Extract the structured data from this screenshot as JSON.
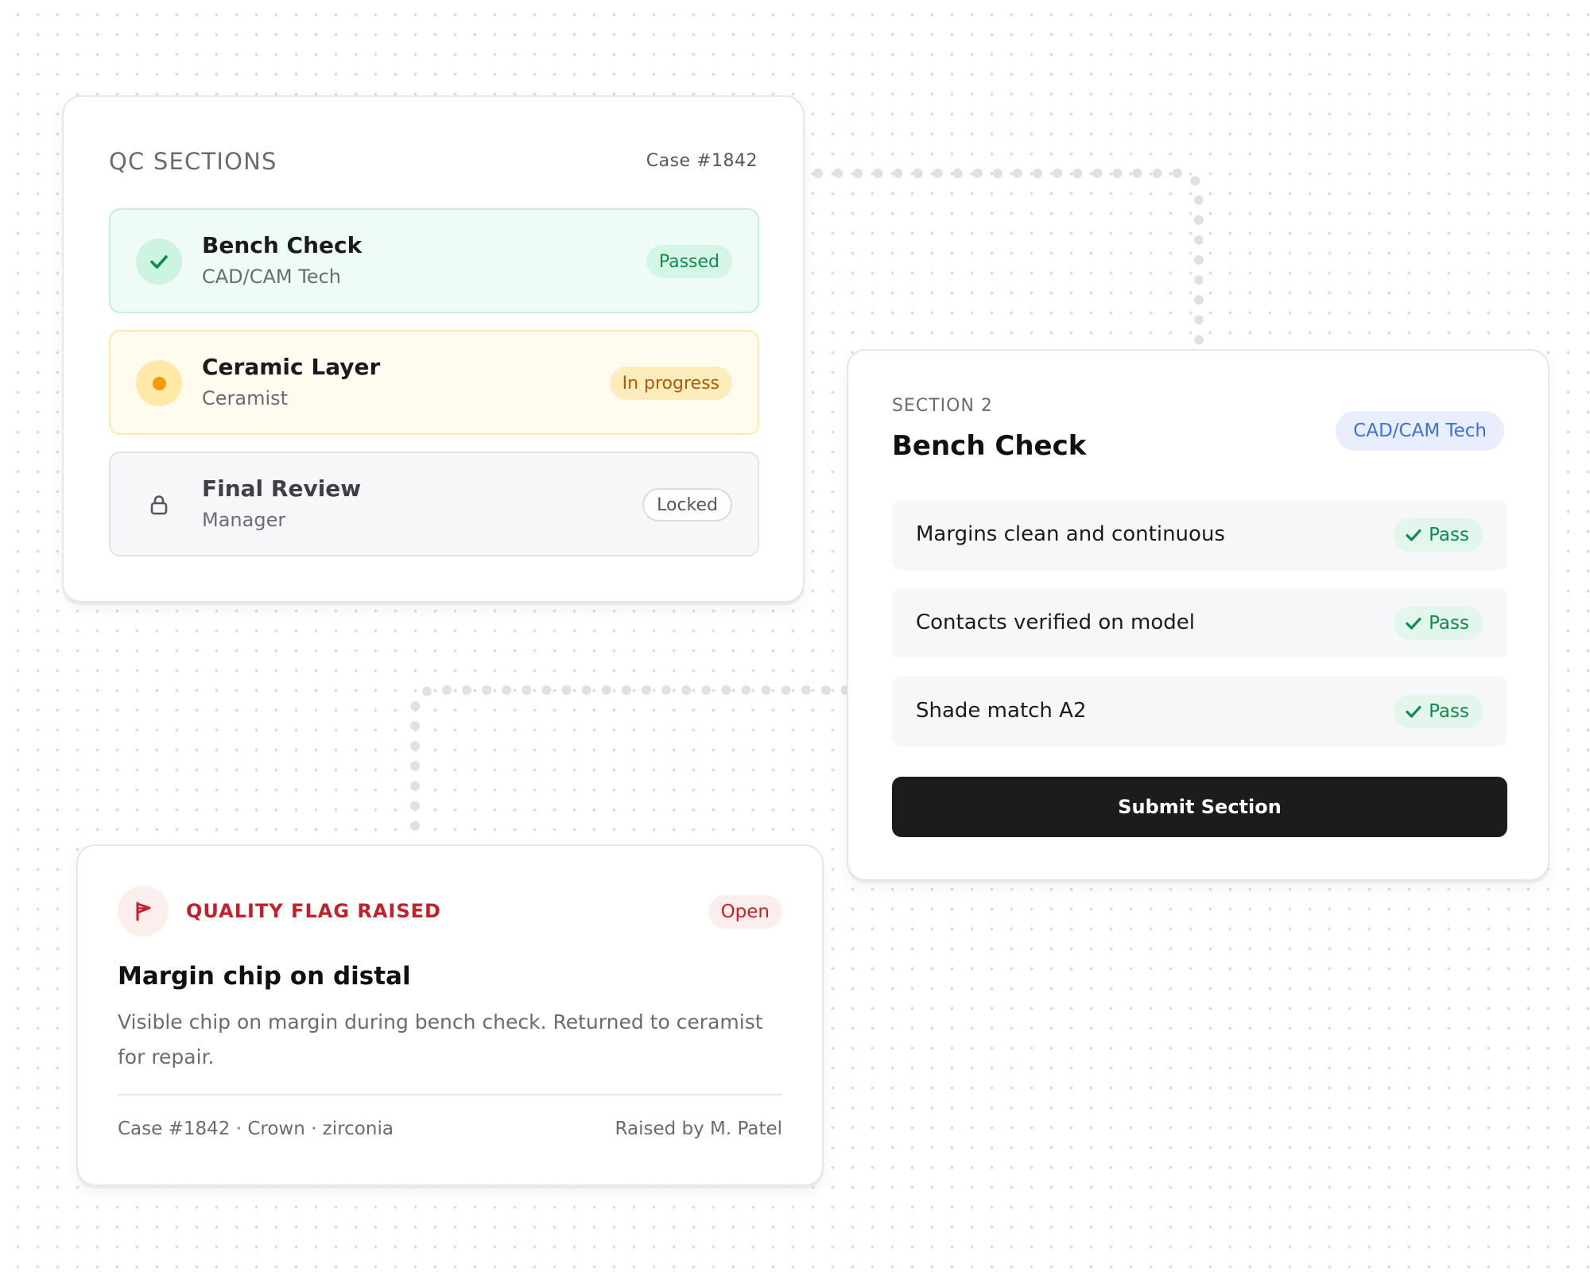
{
  "qc_panel": {
    "title": "QC SECTIONS",
    "case_label": "Case #1842",
    "sections": [
      {
        "name": "Bench Check",
        "role": "CAD/CAM Tech",
        "status": "Passed",
        "icon": "check-icon"
      },
      {
        "name": "Ceramic Layer",
        "role": "Ceramist",
        "status": "In progress",
        "icon": "progress-dot-icon"
      },
      {
        "name": "Final Review",
        "role": "Manager",
        "status": "Locked",
        "icon": "lock-icon"
      }
    ]
  },
  "section_detail": {
    "kicker": "SECTION 2",
    "title": "Bench Check",
    "role_badge": "CAD/CAM Tech",
    "checks": [
      {
        "label": "Margins clean and continuous",
        "result": "Pass"
      },
      {
        "label": "Contacts verified on model",
        "result": "Pass"
      },
      {
        "label": "Shade match A2",
        "result": "Pass"
      }
    ],
    "submit_label": "Submit Section"
  },
  "quality_flag": {
    "label": "QUALITY FLAG RAISED",
    "status": "Open",
    "title": "Margin chip on distal",
    "description": "Visible chip on margin during bench check. Returned to ceramist for repair.",
    "meta": "Case #1842 · Crown · zirconia",
    "raised_by": "Raised by M. Patel",
    "icon": "flag-icon"
  },
  "colors": {
    "passed": "#118a4e",
    "in_progress": "#b5580a",
    "flag_red": "#c4202c",
    "role_blue": "#3f6fe0",
    "button_dark": "#1c1c1c"
  }
}
